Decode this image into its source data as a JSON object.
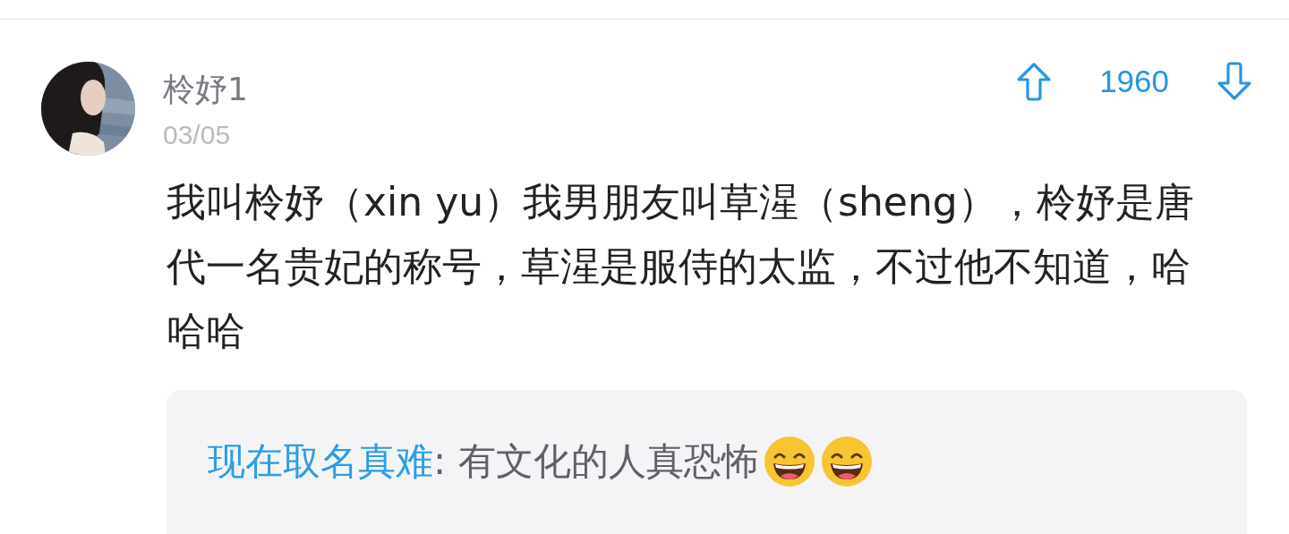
{
  "comment": {
    "author": "柃妤1",
    "date": "03/05",
    "votes": "1960",
    "text": "我叫柃妤（xin yu）我男朋友叫草湦（sheng），柃妤是唐代一名贵妃的称号，草湦是服侍的太监，不过他不知道，哈哈哈",
    "reply": {
      "author": "现在取名真难",
      "text": ": 有文化的人真恐怖",
      "emojis": [
        {
          "kind": "grin"
        },
        {
          "kind": "grin"
        }
      ]
    }
  }
}
